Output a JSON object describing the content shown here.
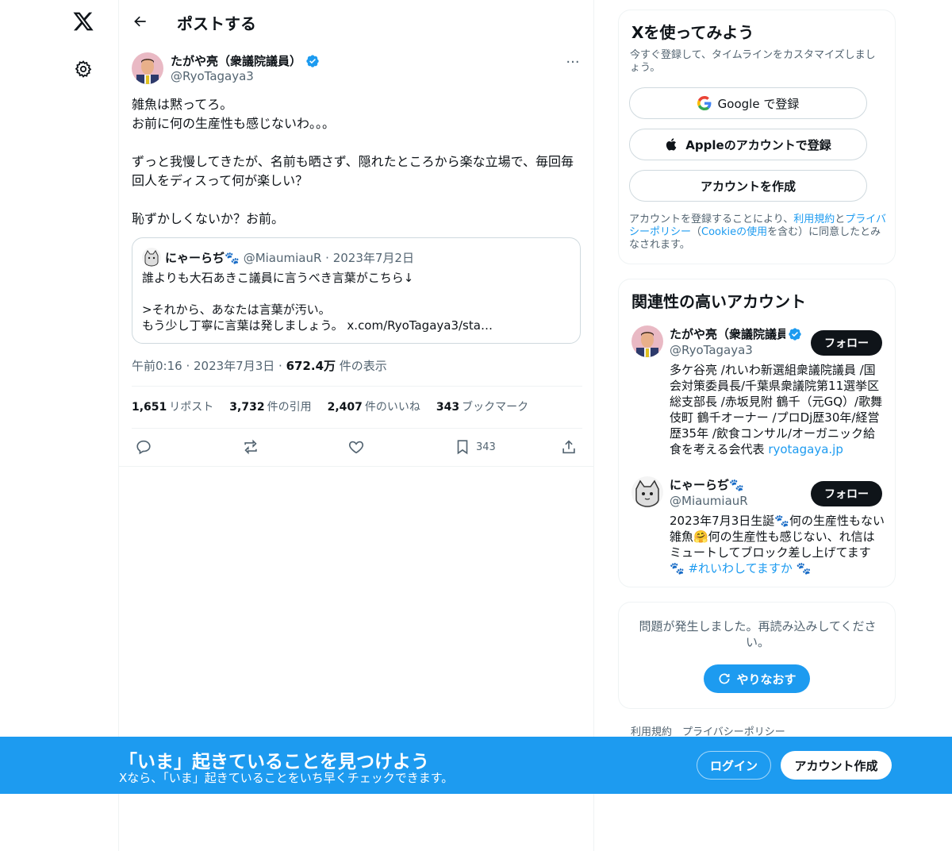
{
  "nav": {
    "logo_icon": "x-logo-icon",
    "settings_icon": "gear-icon"
  },
  "header": {
    "title": "ポストする",
    "back_icon": "arrow-left-icon"
  },
  "post": {
    "author_name": "たがや亮（衆議院議員）",
    "author_handle": "@RyoTagaya3",
    "more_label": "···",
    "body": "雑魚は黙ってろ。\nお前に何の生産性も感じないわ。。。\n\nずっと我慢してきたが、名前も晒さず、隠れたところから楽な立場で、毎回毎回人をディスって何が楽しい？\n\n恥ずかしくないか？お前。",
    "quote": {
      "author_name": "にゃーらぢ🐾",
      "meta": "@MiaumiauR · 2023年7月2日",
      "text": "誰よりも大石あきこ議員に言うべき言葉がこちら↓\n\n>それから、あなたは言葉が汚い。\nもう少し丁寧に言葉は発しましょう。 x.com/RyoTagaya3/sta…"
    },
    "timestamp": "午前0:16 · 2023年7月3日 · ",
    "views_count": "672.4万",
    "views_label": " 件の表示",
    "stats": [
      {
        "count": "1,651",
        "label": "リポスト"
      },
      {
        "count": "3,732",
        "label": "件の引用"
      },
      {
        "count": "2,407",
        "label": "件のいいね"
      },
      {
        "count": "343",
        "label": "ブックマーク"
      }
    ],
    "bookmark_count": "343"
  },
  "signup": {
    "title": "Xを使ってみよう",
    "subtitle": "今すぐ登録して、タイムラインをカスタマイズしましょう。",
    "google_label": "Google で登録",
    "apple_label": "Appleのアカウントで登録",
    "create_label": "アカウントを作成",
    "terms_1": "アカウントを登録することにより、",
    "terms_link1": "利用規約",
    "terms_2": "と",
    "terms_link2": "プライバシーポリシー",
    "terms_3": "（",
    "terms_link3": "Cookieの使用",
    "terms_4": "を含む）に同意したとみなされます。"
  },
  "related": {
    "title": "関連性の高いアカウント",
    "accounts": [
      {
        "name": "たがや亮（衆議院議員）",
        "handle": "@RyoTagaya3",
        "follow": "フォロー",
        "bio": "多ケ谷亮 /れいわ新選組衆議院議員 /国会対策委員長/千葉県衆議院第11選挙区総支部長 /赤坂見附 鶴千（元GQ）/歌舞伎町 鶴千オーナー /プロDj歴30年/経営歴35年 /飲食コンサル/オーガニック給食を考える会代表 ",
        "link": "ryotagaya.jp"
      },
      {
        "name": "にゃーらぢ🐾",
        "handle": "@MiaumiauR",
        "follow": "フォロー",
        "bio": "2023年7月3日生誕🐾何の生産性もない雑魚🤗何の生産性も感じない、れ信はミュートしてブロック差し上げてます🐾 ",
        "link": "#れいわしてますか",
        "bio_tail": " 🐾"
      }
    ]
  },
  "error": {
    "text": "問題が発生しました。再読み込みしてください。",
    "retry_label": "やりなおす"
  },
  "footer": {
    "links": [
      "利用規約",
      "プライバシーポリシー"
    ]
  },
  "banner": {
    "title": "「いま」起きていることを見つけよう",
    "subtitle": "Xなら、「いま」起きていることをいち早くチェックできます。",
    "login_label": "ログイン",
    "create_label": "アカウント作成"
  },
  "colors": {
    "accent": "#1d9bf0",
    "text": "#0f1419",
    "muted": "#536471",
    "border": "#eff3f4"
  }
}
